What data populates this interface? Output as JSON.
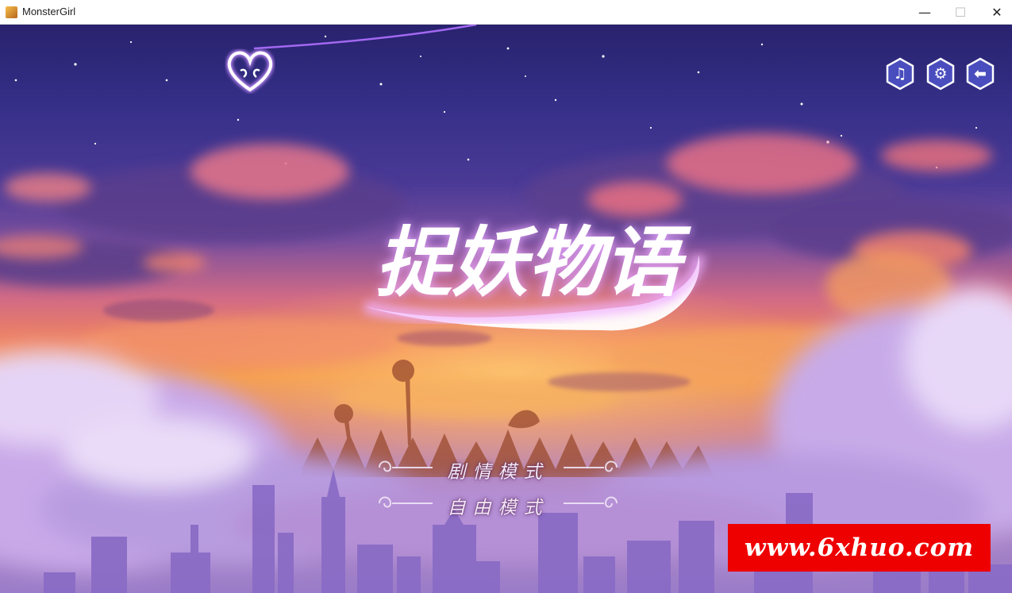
{
  "window": {
    "title": "MonsterGirl",
    "minimize_symbol": "—",
    "maximize_symbol": "☐",
    "close_symbol": "✕"
  },
  "game": {
    "logo_text": "捉妖物语",
    "menu": [
      {
        "label": "剧情模式"
      },
      {
        "label": "自由模式"
      }
    ],
    "top_buttons": [
      {
        "icon": "music-note-icon",
        "glyph": "♫"
      },
      {
        "icon": "gear-icon",
        "glyph": "⚙"
      },
      {
        "icon": "arrow-left-icon",
        "glyph": "⬅"
      }
    ]
  },
  "watermark": {
    "text": "www.6xhuo.com"
  },
  "colors": {
    "sky_top": "#28226e",
    "sunset": "#f0845e",
    "mist": "#b489c2",
    "button_fill": "#4a4dbe",
    "watermark_bg": "#ef0000"
  }
}
